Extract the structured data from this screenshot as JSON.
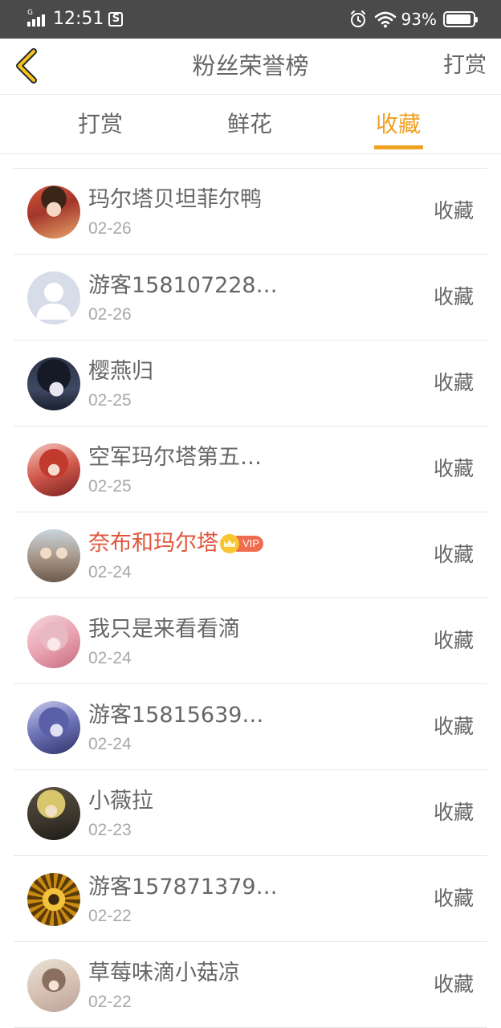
{
  "status_bar": {
    "network_type": "G",
    "time": "12:51",
    "notification_icon": "s-icon",
    "alarm_icon": "alarm-icon",
    "wifi_icon": "wifi-icon",
    "battery_percent": "93%",
    "battery_level": 0.93
  },
  "header": {
    "back_icon": "chevron-left-icon",
    "title": "粉丝荣誉榜",
    "right_button": "打赏"
  },
  "tabs": [
    {
      "label": "打赏",
      "active": false
    },
    {
      "label": "鲜花",
      "active": false
    },
    {
      "label": "收藏",
      "active": true
    }
  ],
  "accent_color": "#f0a020",
  "vip_name_color": "#e0563c",
  "rows": [
    {
      "name": "玛尔塔贝坦菲尔鸭",
      "date": "02-26",
      "action": "收藏"
    },
    {
      "name": "游客158107228…",
      "date": "02-26",
      "action": "收藏"
    },
    {
      "name": "樱燕归",
      "date": "02-25",
      "action": "收藏"
    },
    {
      "name": "空军玛尔塔第五…",
      "date": "02-25",
      "action": "收藏"
    },
    {
      "name": "奈布和玛尔塔",
      "date": "02-24",
      "action": "收藏",
      "vip": "VIP"
    },
    {
      "name": "我只是来看看滴",
      "date": "02-24",
      "action": "收藏"
    },
    {
      "name": "游客15815639…",
      "date": "02-24",
      "action": "收藏"
    },
    {
      "name": "小薇拉",
      "date": "02-23",
      "action": "收藏"
    },
    {
      "name": "游客157871379…",
      "date": "02-22",
      "action": "收藏"
    },
    {
      "name": "草莓味滴小菇凉",
      "date": "02-22",
      "action": "收藏"
    }
  ]
}
